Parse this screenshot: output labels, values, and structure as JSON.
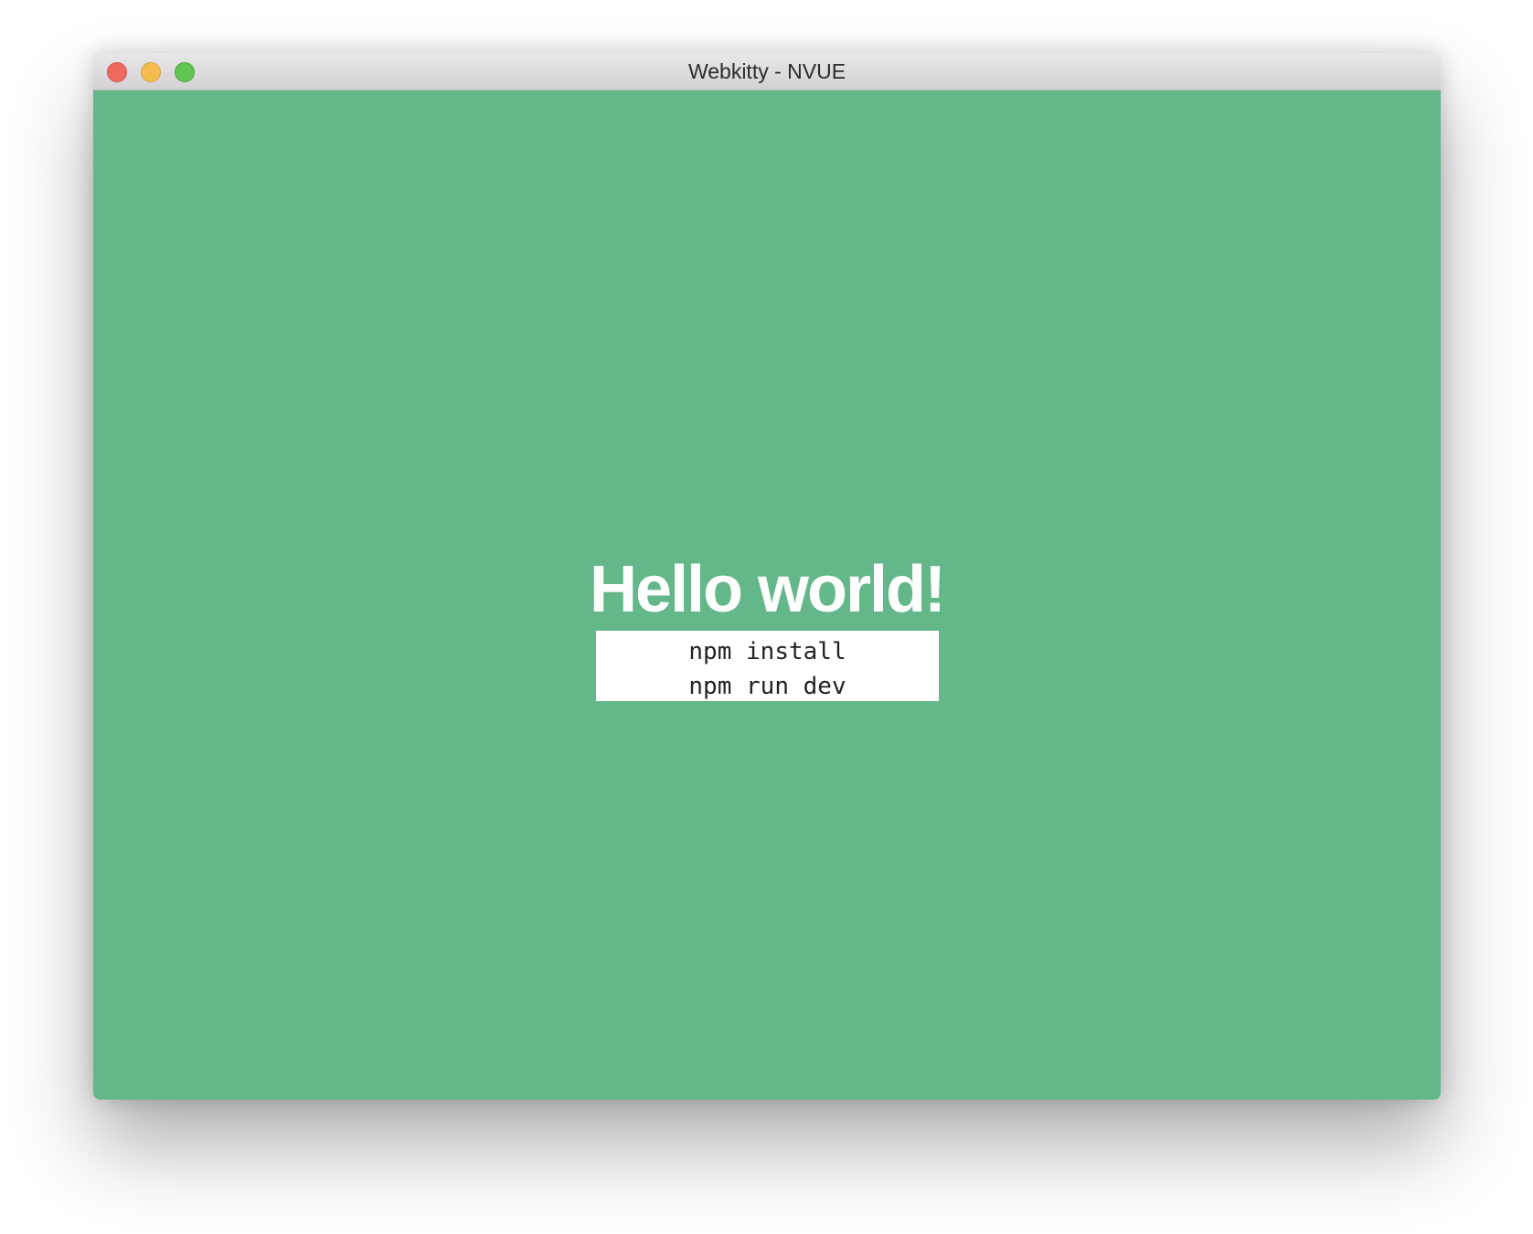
{
  "window": {
    "title": "Webkitty - NVUE",
    "controls": [
      "close",
      "minimize",
      "zoom"
    ],
    "background_color": "#63b788"
  },
  "main": {
    "heading": "Hello world!",
    "commands": [
      "npm install",
      "npm run dev"
    ]
  }
}
